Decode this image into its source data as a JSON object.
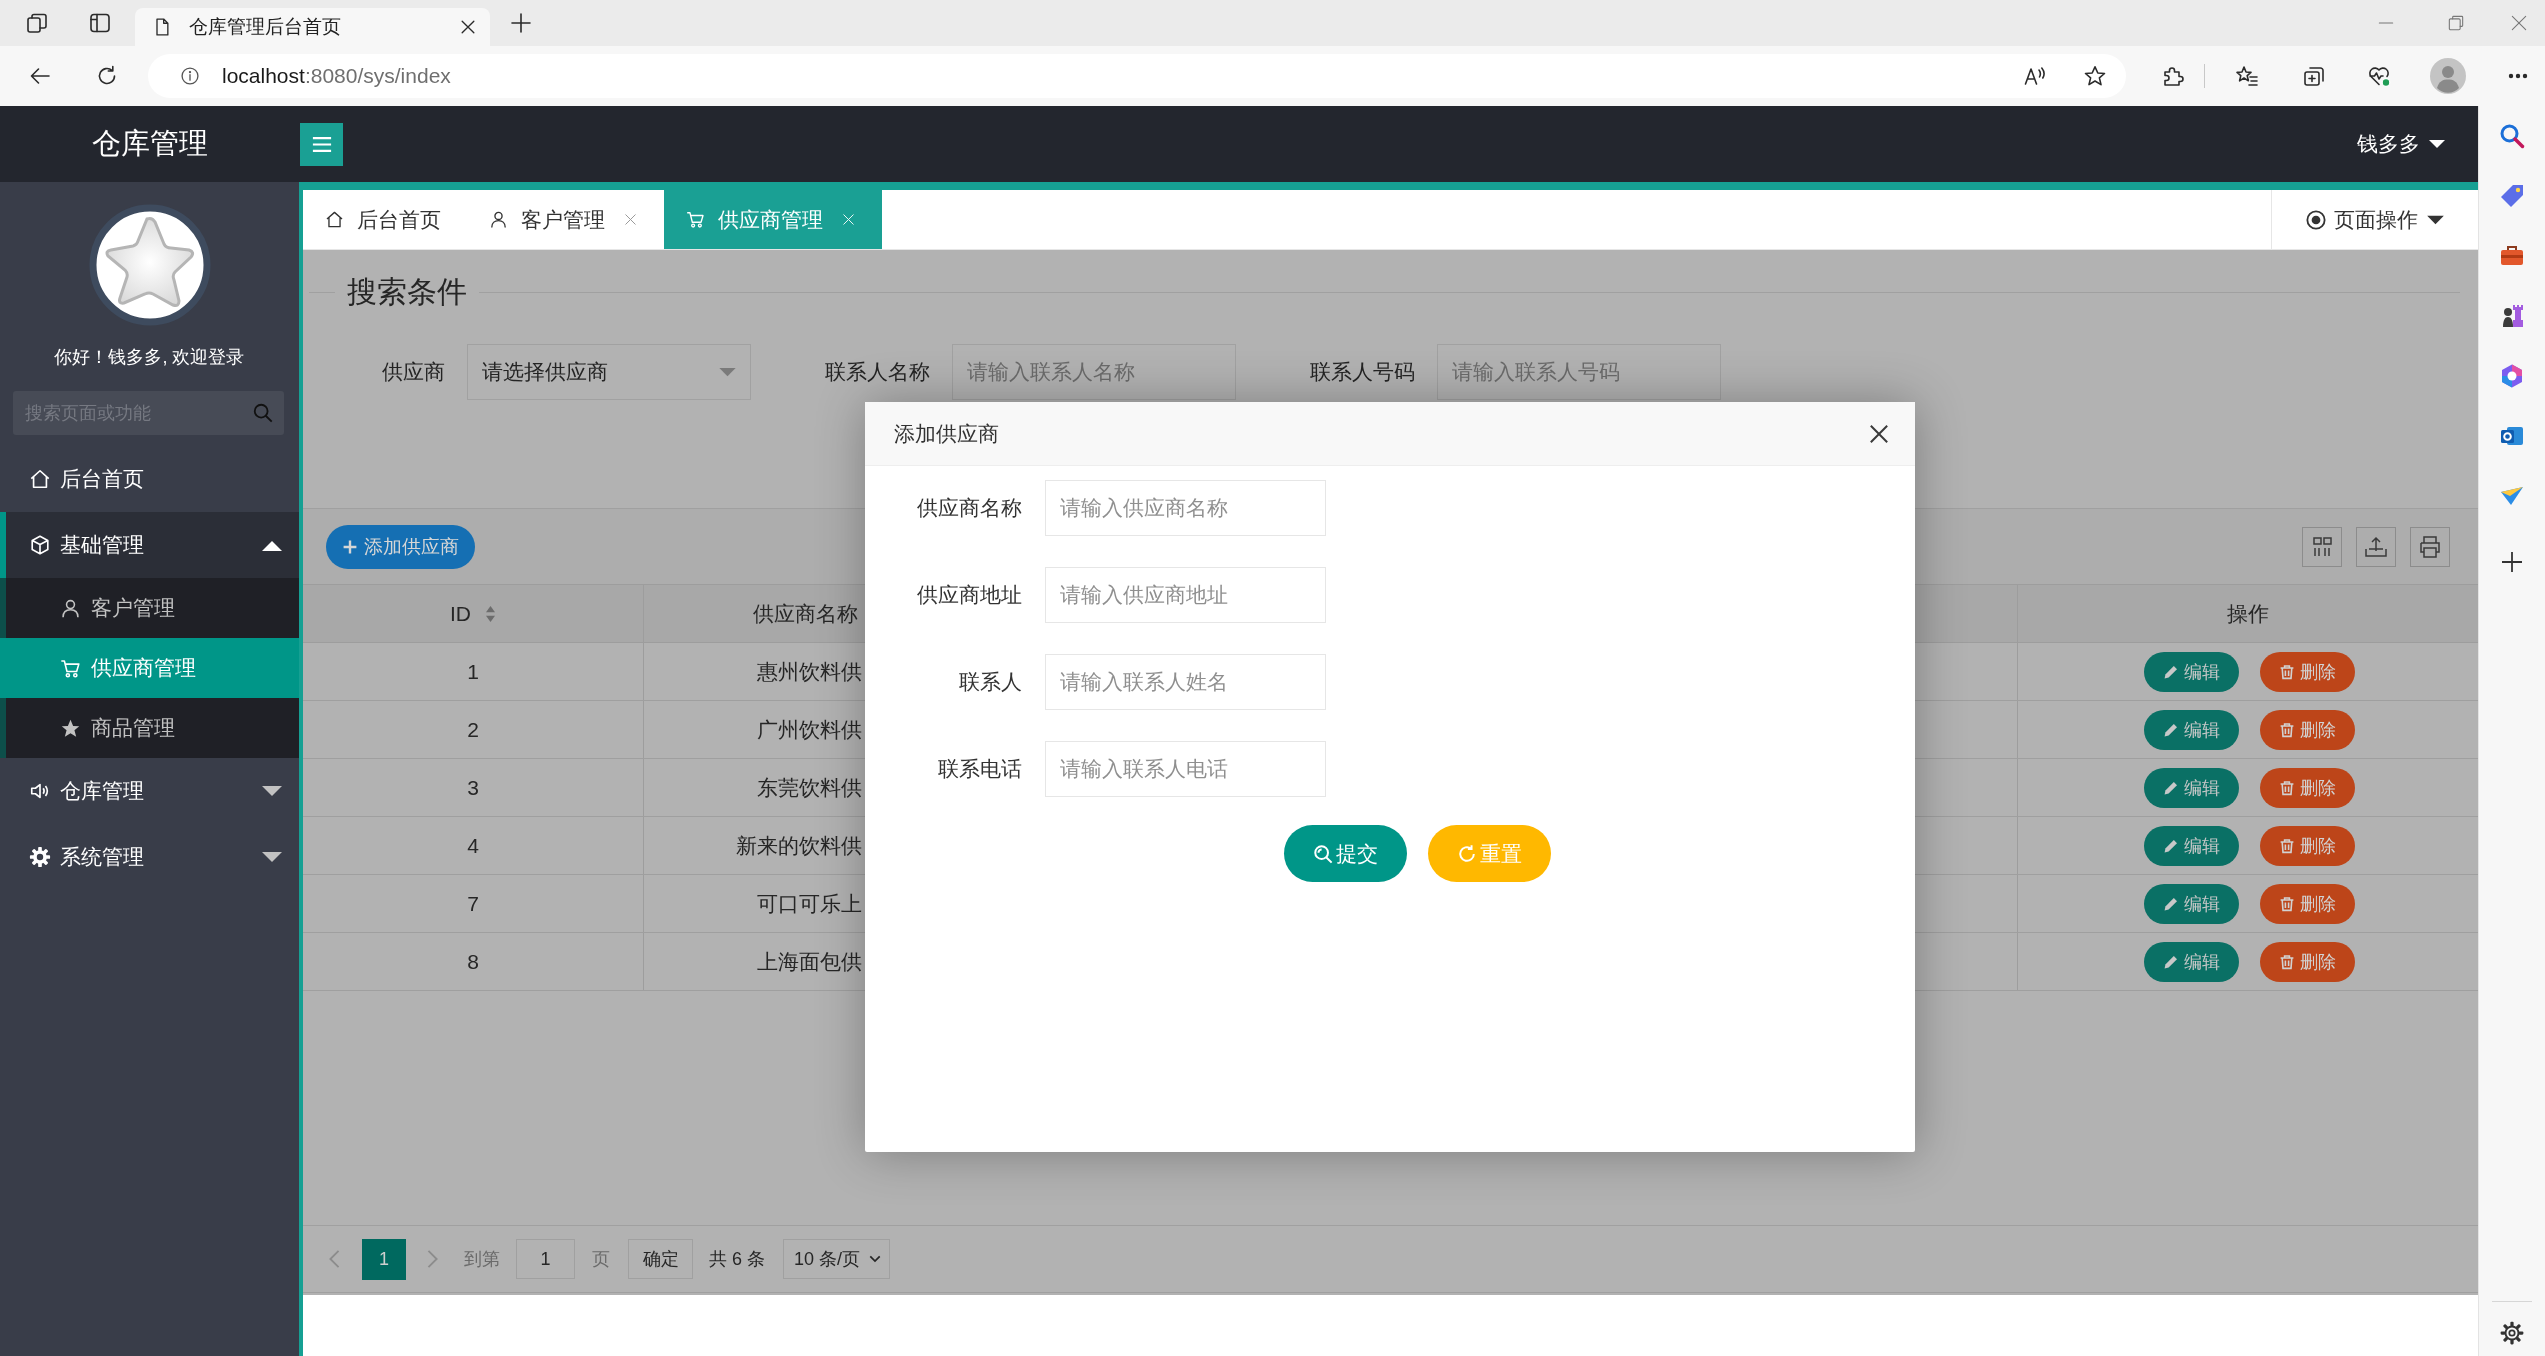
{
  "browser": {
    "tab_title": "仓库管理后台首页",
    "url_host": "localhost",
    "url_path": ":8080/sys/index"
  },
  "header": {
    "logo": "仓库管理",
    "user": "钱多多"
  },
  "sidebar": {
    "greeting": "你好！钱多多, 欢迎登录",
    "search": {
      "placeholder": "搜索页面或功能"
    },
    "items": [
      {
        "label": "后台首页",
        "selected": false
      },
      {
        "label": "基础管理",
        "selected": false,
        "expanded": true,
        "children": [
          {
            "label": "客户管理",
            "selected": false
          },
          {
            "label": "供应商管理",
            "selected": true
          },
          {
            "label": "商品管理",
            "selected": false
          }
        ]
      },
      {
        "label": "仓库管理",
        "selected": false,
        "expanded": false
      },
      {
        "label": "系统管理",
        "selected": false,
        "expanded": false
      }
    ]
  },
  "tabs": [
    {
      "label": "后台首页",
      "selected": false,
      "closable": false
    },
    {
      "label": "客户管理",
      "selected": false,
      "closable": true
    },
    {
      "label": "供应商管理",
      "selected": true,
      "closable": true
    }
  ],
  "page_actions": {
    "label": "页面操作"
  },
  "search": {
    "legend": "搜索条件",
    "fields": [
      {
        "label": "供应商",
        "kind": "select",
        "value": "请选择供应商"
      },
      {
        "label": "联系人名称",
        "kind": "input",
        "placeholder": "请输入联系人名称"
      },
      {
        "label": "联系人号码",
        "kind": "input",
        "placeholder": "请输入联系人号码"
      }
    ]
  },
  "toolbar": {
    "add_button": "添加供应商"
  },
  "table": {
    "columns": [
      {
        "label": "ID",
        "sortable": true
      },
      {
        "label": "供应商名称",
        "sortable": false
      },
      {
        "label": "操作",
        "sortable": false
      }
    ],
    "rows": [
      {
        "id": "1",
        "name": "惠州饮料供",
        "actions": [
          {
            "label": "编辑",
            "kind": "edit"
          },
          {
            "label": "删除",
            "kind": "delete"
          }
        ]
      },
      {
        "id": "2",
        "name": "广州饮料供",
        "actions": [
          {
            "label": "编辑",
            "kind": "edit"
          },
          {
            "label": "删除",
            "kind": "delete"
          }
        ]
      },
      {
        "id": "3",
        "name": "东莞饮料供",
        "actions": [
          {
            "label": "编辑",
            "kind": "edit"
          },
          {
            "label": "删除",
            "kind": "delete"
          }
        ]
      },
      {
        "id": "4",
        "name": "新来的饮料供",
        "actions": [
          {
            "label": "编辑",
            "kind": "edit"
          },
          {
            "label": "删除",
            "kind": "delete"
          }
        ]
      },
      {
        "id": "7",
        "name": "可口可乐上",
        "actions": [
          {
            "label": "编辑",
            "kind": "edit"
          },
          {
            "label": "删除",
            "kind": "delete"
          }
        ]
      },
      {
        "id": "8",
        "name": "上海面包供",
        "actions": [
          {
            "label": "编辑",
            "kind": "edit"
          },
          {
            "label": "删除",
            "kind": "delete"
          }
        ]
      }
    ]
  },
  "pagination": {
    "prev_disabled": true,
    "pages": [
      {
        "label": "1",
        "selected": true
      }
    ],
    "next_disabled": true,
    "goto_label": "到第",
    "goto_value": "1",
    "page_unit": "页",
    "confirm": "确定",
    "total": "共 6 条",
    "page_size": "10 条/页"
  },
  "modal": {
    "title": "添加供应商",
    "fields": [
      {
        "label": "供应商名称",
        "placeholder": "请输入供应商名称"
      },
      {
        "label": "供应商地址",
        "placeholder": "请输入供应商地址"
      },
      {
        "label": "联系人",
        "placeholder": "请输入联系人姓名"
      },
      {
        "label": "联系电话",
        "placeholder": "请输入联系人电话"
      }
    ],
    "buttons": [
      {
        "label": "提交",
        "kind": "submit"
      },
      {
        "label": "重置",
        "kind": "reset"
      }
    ]
  }
}
